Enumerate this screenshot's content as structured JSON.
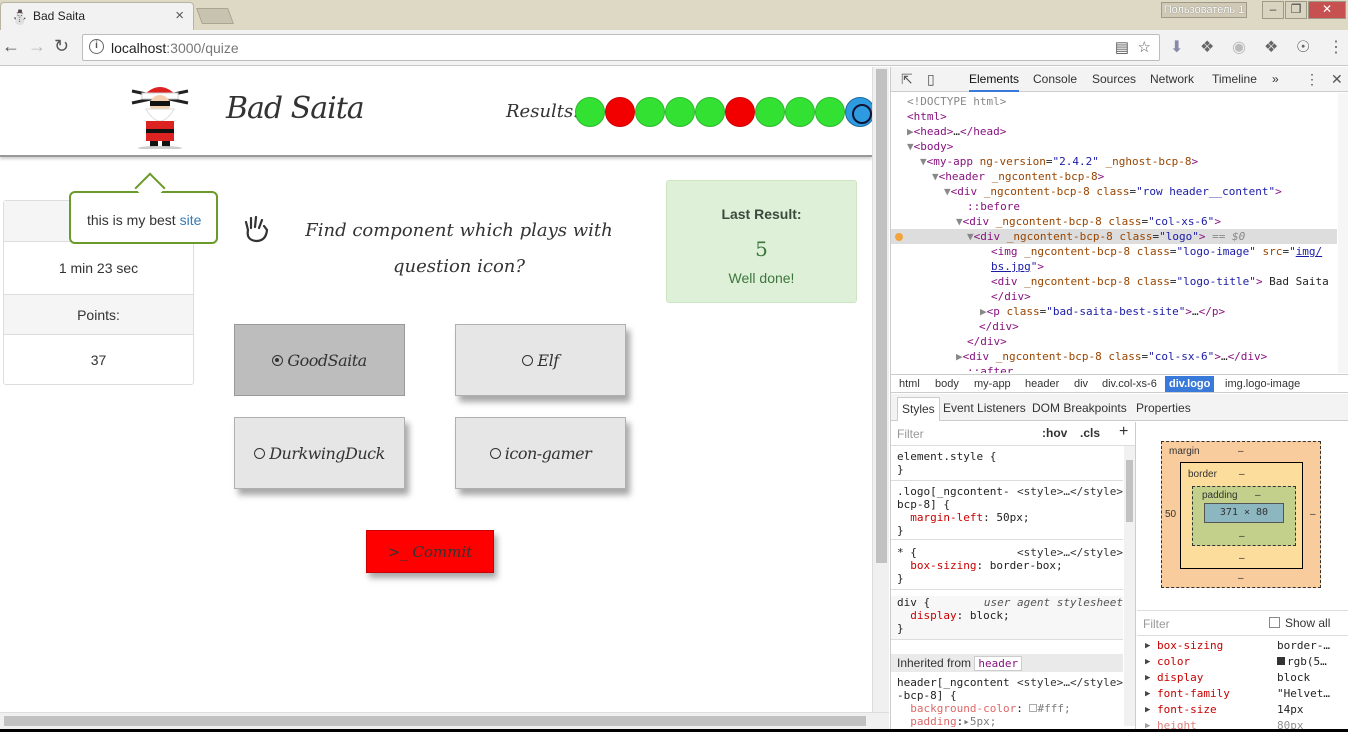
{
  "browser": {
    "tab_title": "Bad Saita",
    "profile": "Пользователь 1",
    "url_host": "localhost",
    "url_path": ":3000/quize"
  },
  "header": {
    "logo_title": "Bad Saita",
    "results_label": "Results:",
    "results": [
      "correct",
      "wrong",
      "correct",
      "correct",
      "correct",
      "wrong",
      "correct",
      "correct",
      "correct",
      "current"
    ]
  },
  "tooltip": {
    "text": "this is my best",
    "link": "site"
  },
  "stats": {
    "time_value": "1 min 23 sec",
    "points_label": "Points:",
    "points_value": "37"
  },
  "quiz": {
    "question": "Find component which plays with question icon?",
    "options": [
      {
        "label": "GoodSaita",
        "selected": true
      },
      {
        "label": "Elf",
        "selected": false
      },
      {
        "label": "DurkwingDuck",
        "selected": false
      },
      {
        "label": "icon-gamer",
        "selected": false
      }
    ],
    "commit_label": ">_ Commit"
  },
  "last_result": {
    "title": "Last Result:",
    "value": "5",
    "message": "Well done!"
  },
  "devtools": {
    "tabs": [
      "Elements",
      "Console",
      "Sources",
      "Network",
      "Timeline"
    ],
    "active_tab": "Elements",
    "more": "»",
    "breadcrumb": [
      "html",
      "body",
      "my-app",
      "header",
      "div",
      "div.col-xs-6",
      "div.logo",
      "img.logo-image"
    ],
    "subtabs": [
      "Styles",
      "Event Listeners",
      "DOM Breakpoints",
      "Properties"
    ],
    "filter_placeholder": "Filter",
    "hov": ":hov",
    "cls": ".cls",
    "plus": "+",
    "inherited_from": "Inherited from",
    "inherited_tag": "header",
    "computed_filter": "Filter",
    "show_all": "Show all",
    "box": {
      "margin_label": "margin",
      "border_label": "border",
      "padding_label": "padding",
      "content": "371 × 80",
      "left": "50",
      "dash": "–"
    },
    "selected_line_suffix": "== $0"
  }
}
